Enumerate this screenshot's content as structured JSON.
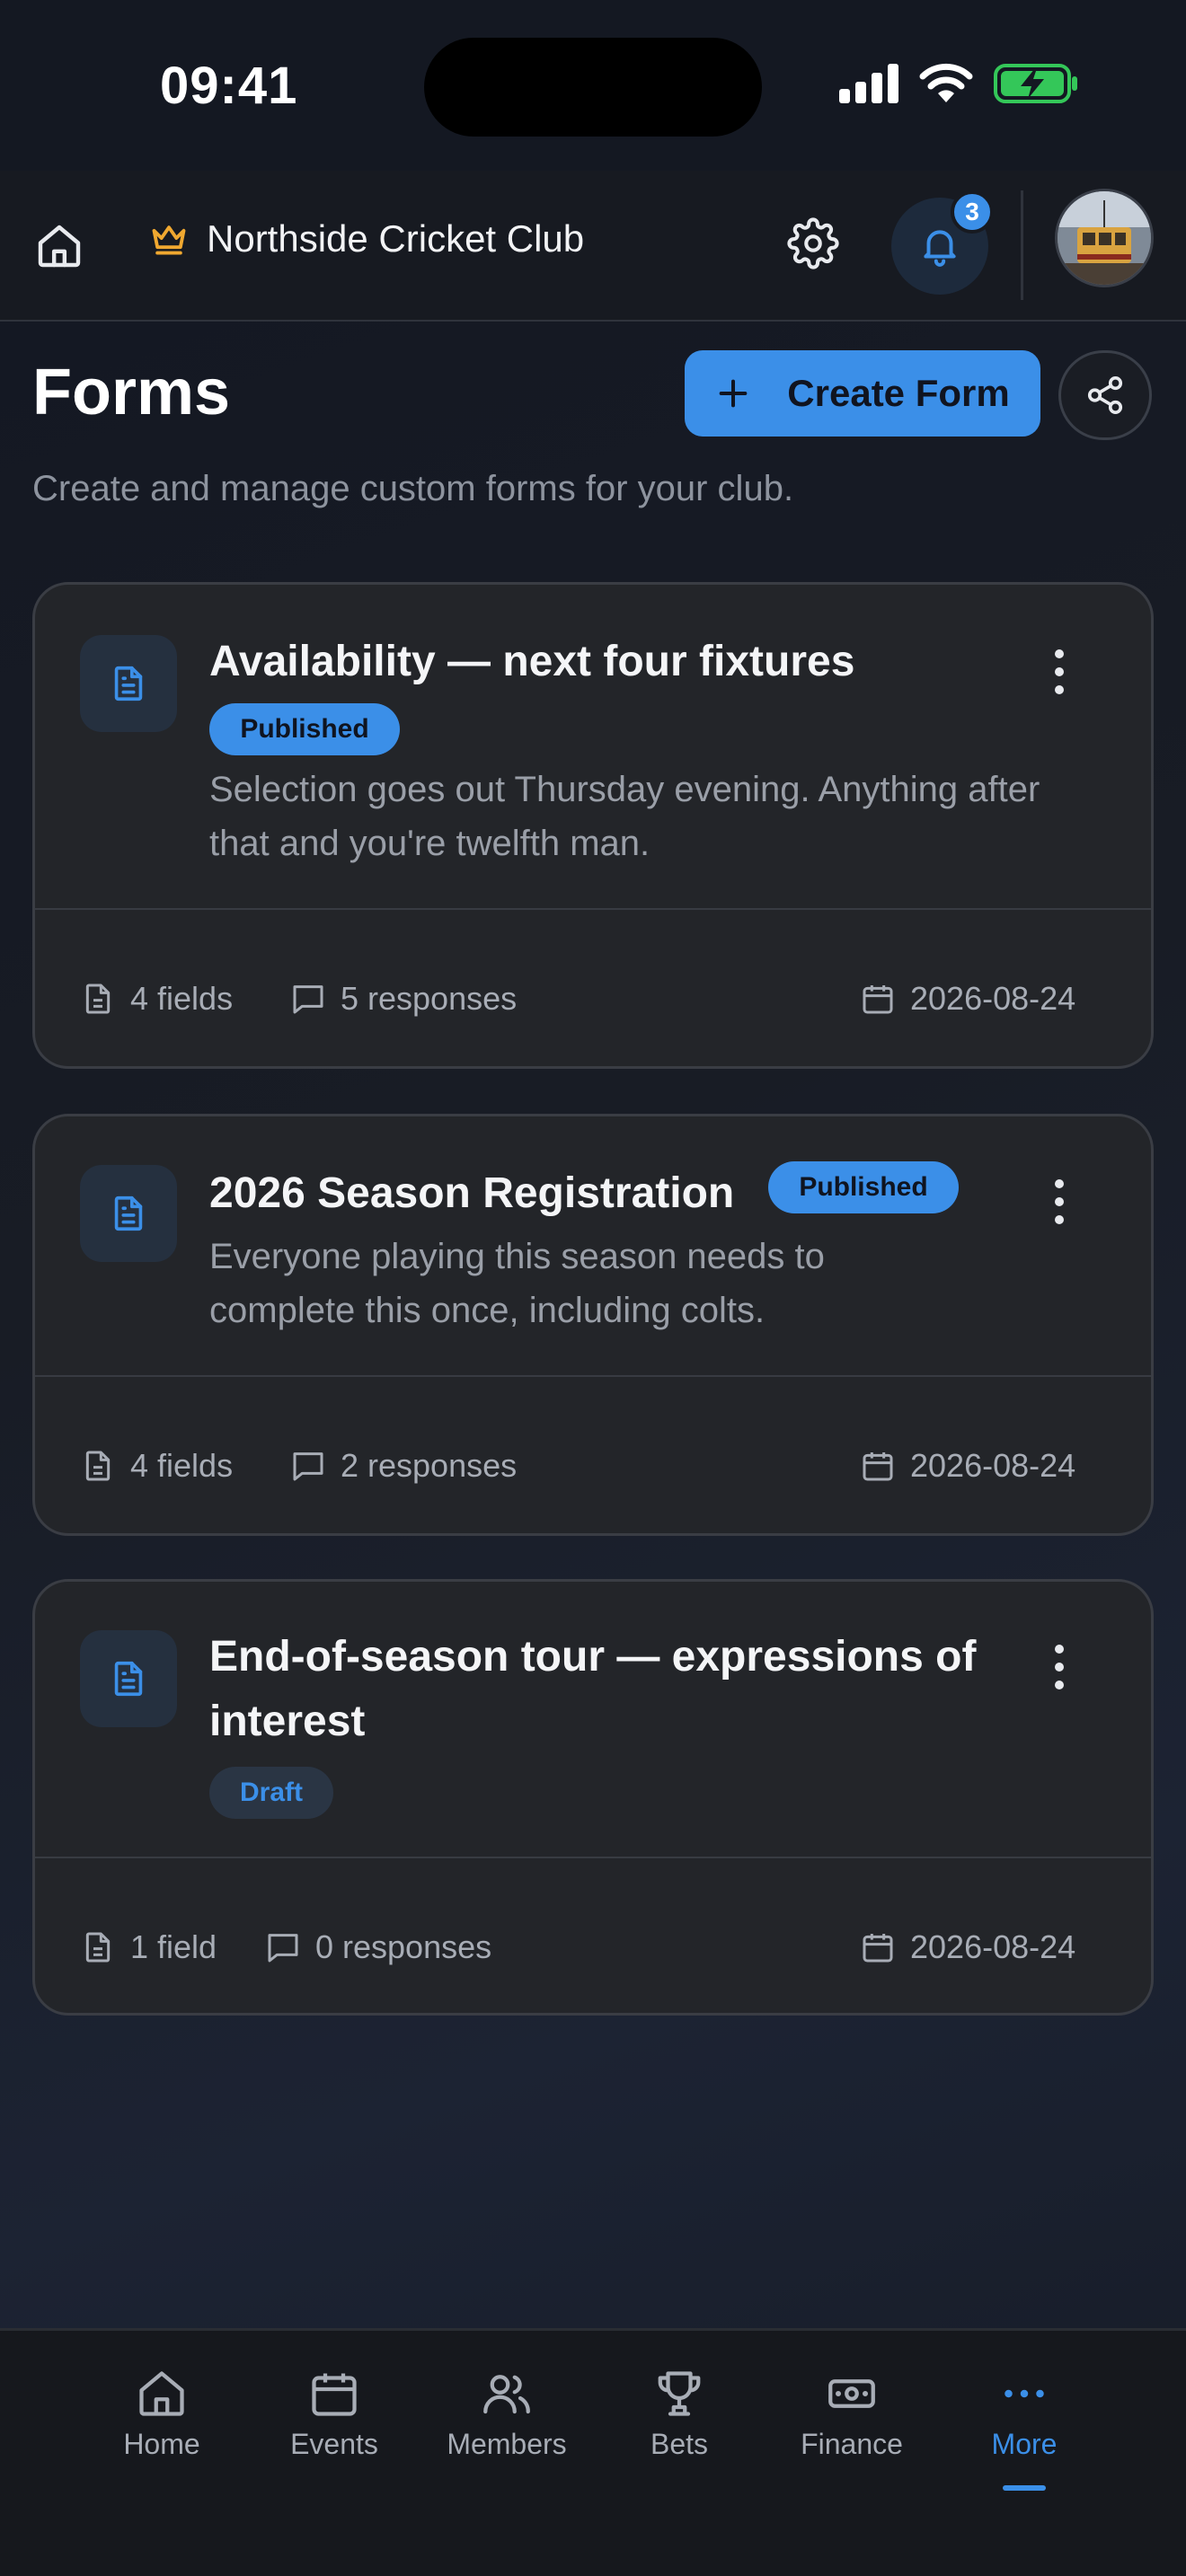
{
  "status_bar": {
    "time": "09:41"
  },
  "header": {
    "club_name": "Northside Cricket Club",
    "notification_count": "3"
  },
  "page": {
    "title": "Forms",
    "create_button": "Create Form",
    "subtitle": "Create and manage custom forms for your club."
  },
  "forms": [
    {
      "title": "Availability — next four fixtures",
      "status": "Published",
      "description": "Selection goes out Thursday evening. Anything after that and you're twelfth man.",
      "fields": "4 fields",
      "responses": "5 responses",
      "date": "2026-08-24"
    },
    {
      "title": "2026 Season Registration",
      "status": "Published",
      "description": "Everyone playing this season needs to complete this once, including colts.",
      "fields": "4 fields",
      "responses": "2 responses",
      "date": "2026-08-24"
    },
    {
      "title": "End-of-season tour — expressions of interest",
      "status": "Draft",
      "description": "",
      "fields": "1 field",
      "responses": "0 responses",
      "date": "2026-08-24"
    }
  ],
  "nav": {
    "items": [
      "Home",
      "Events",
      "Members",
      "Bets",
      "Finance",
      "More"
    ],
    "active": "More"
  },
  "colors": {
    "accent": "#3b8fe8",
    "crown": "#f0a830",
    "battery": "#34c759"
  }
}
